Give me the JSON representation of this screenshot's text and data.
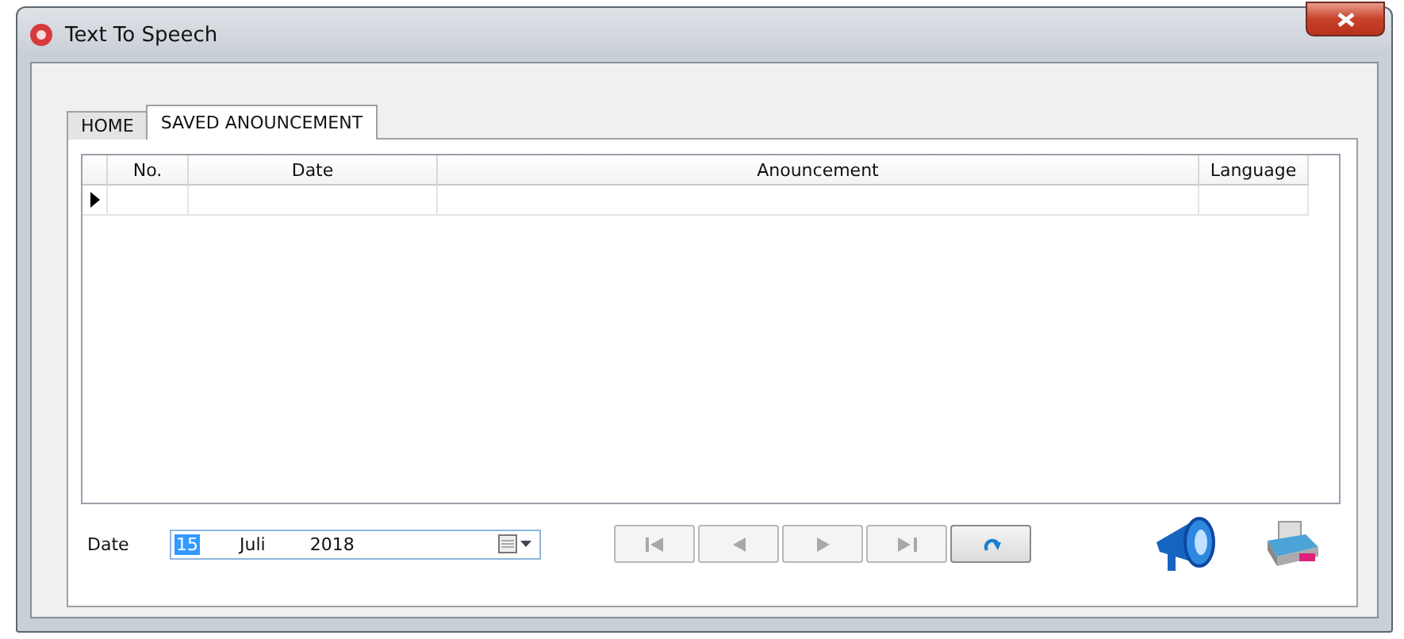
{
  "window": {
    "title": "Text To Speech"
  },
  "tabs": [
    {
      "label": "HOME",
      "selected": false
    },
    {
      "label": "SAVED ANOUNCEMENT",
      "selected": true
    }
  ],
  "table": {
    "columns": [
      "No.",
      "Date",
      "Anouncement",
      "Language"
    ],
    "rows": [
      {
        "current": true,
        "cells": [
          "",
          "",
          "",
          ""
        ]
      }
    ]
  },
  "date_field": {
    "label": "Date",
    "parts": [
      {
        "text": "15",
        "selected": true
      },
      {
        "text": "Juli",
        "selected": false
      },
      {
        "text": "2018",
        "selected": false
      }
    ]
  },
  "navigator": [
    {
      "kind": "first",
      "disabled": true
    },
    {
      "kind": "prev",
      "disabled": true
    },
    {
      "kind": "next",
      "disabled": true
    },
    {
      "kind": "last",
      "disabled": true
    },
    {
      "kind": "refresh",
      "disabled": false
    }
  ]
}
